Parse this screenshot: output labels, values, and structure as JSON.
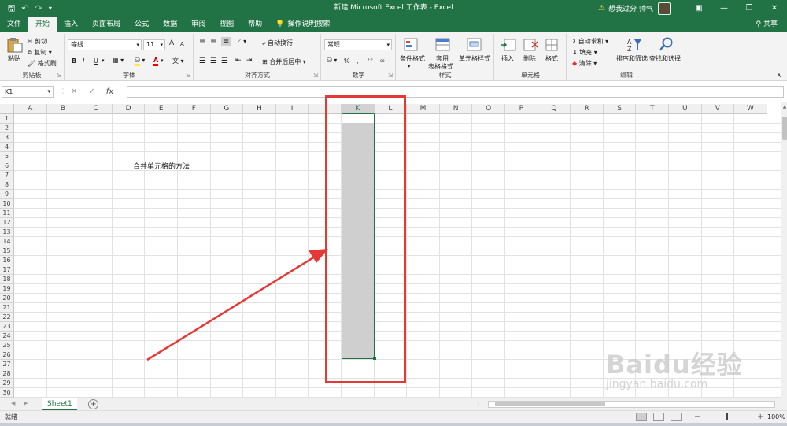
{
  "titlebar": {
    "title": "新建 Microsoft Excel 工作表 - Excel",
    "user": "想我过分 帅气",
    "qat": {
      "save": "🖫",
      "undo": "↶",
      "redo": "↷",
      "more": "▾"
    },
    "win": {
      "ribbon": "▣",
      "minimize": "—",
      "restore": "❐",
      "close": "✕"
    }
  },
  "tabs": [
    "文件",
    "开始",
    "插入",
    "页面布局",
    "公式",
    "数据",
    "审阅",
    "视图",
    "帮助"
  ],
  "tell_me": "操作说明搜索",
  "share": "共享",
  "ribbon": {
    "clipboard": {
      "label": "剪贴板",
      "paste": "粘贴",
      "cut": "剪切",
      "copy": "复制",
      "format_painter": "格式刷"
    },
    "font": {
      "label": "字体",
      "name": "等线",
      "size": "11",
      "bold": "B",
      "italic": "I",
      "underline": "U",
      "color_a": "A",
      "grow": "A",
      "shrink": "A",
      "wen": "文"
    },
    "alignment": {
      "label": "对齐方式",
      "wrap": "自动换行",
      "merge": "合并后居中"
    },
    "number": {
      "label": "数字",
      "format": "常规",
      "percent": "%",
      "comma": ","
    },
    "styles": {
      "label": "样式",
      "conditional": "条件格式",
      "table_l1": "套用",
      "table_l2": "表格格式",
      "cell_styles": "单元格样式"
    },
    "cells": {
      "label": "单元格",
      "insert": "插入",
      "delete": "删除",
      "format": "格式"
    },
    "editing": {
      "label": "编辑",
      "autosum": "自动求和",
      "fill": "填充",
      "clear": "清除",
      "sort": "排序和筛选",
      "find": "查找和选择"
    }
  },
  "formula_bar": {
    "name_box": "K1",
    "cancel": "✕",
    "enter": "✓",
    "fx": "fx",
    "content": ""
  },
  "grid": {
    "columns": [
      "A",
      "B",
      "C",
      "D",
      "E",
      "F",
      "G",
      "H",
      "I",
      "",
      "K",
      "L",
      "M",
      "N",
      "O",
      "P",
      "Q",
      "R",
      "S",
      "T",
      "U",
      "V",
      "W"
    ],
    "selected_column": "K",
    "rows": [
      "1",
      "2",
      "3",
      "4",
      "5",
      "6",
      "7",
      "8",
      "9",
      "10",
      "11",
      "12",
      "13",
      "14",
      "15",
      "16",
      "17",
      "18",
      "19",
      "20",
      "21",
      "22",
      "23",
      "24",
      "25",
      "26",
      "27",
      "28",
      "29",
      "30"
    ],
    "cell_text": "合并单元格的方法"
  },
  "sheets": {
    "active": "Sheet1",
    "add": "+",
    "prev": "◀",
    "next": "▶"
  },
  "status": {
    "text": "就绪",
    "zoom": "100%",
    "minus": "−",
    "plus": "+"
  },
  "watermark": {
    "main": "Baidu经验",
    "sub": "jingyan.baidu.com"
  },
  "colors": {
    "accent": "#217346",
    "annotation": "#e53935"
  }
}
